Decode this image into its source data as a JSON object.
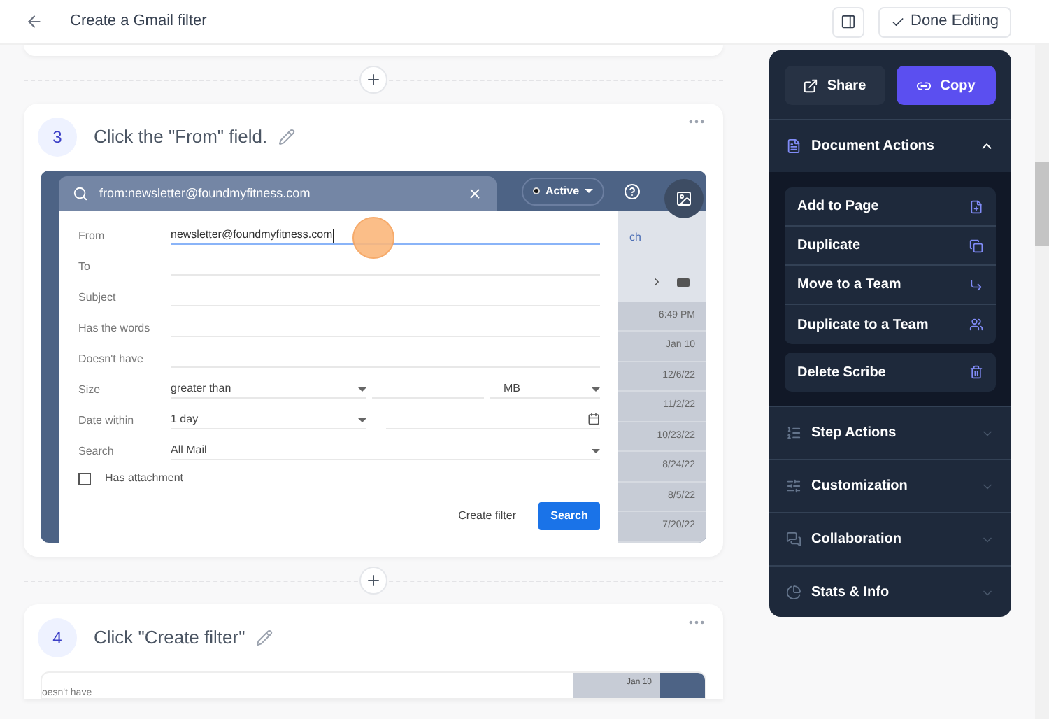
{
  "header": {
    "title": "Create a Gmail filter",
    "done_button": "Done Editing"
  },
  "steps": [
    {
      "number": "3",
      "title": "Click the \"From\" field.",
      "kind": "full",
      "screenshot": {
        "search_query": "from:newsletter@foundmyfitness.com",
        "status": "Active",
        "side_text": "ch",
        "fields": [
          {
            "kind": "text",
            "label": "From",
            "value": "newsletter@foundmyfitness.com",
            "focused": true
          },
          {
            "kind": "text",
            "label": "To",
            "focused": false
          },
          {
            "kind": "text",
            "label": "Subject",
            "focused": false
          },
          {
            "kind": "text",
            "label": "Has the words",
            "focused": false
          },
          {
            "kind": "text",
            "label": "Doesn't have",
            "focused": false
          },
          {
            "kind": "size",
            "label": "Size",
            "value": "greater than",
            "unit": "MB"
          },
          {
            "kind": "date",
            "label": "Date within",
            "value": "1 day"
          },
          {
            "kind": "select",
            "label": "Search",
            "value": "All Mail"
          }
        ],
        "attachment": {
          "label": "Has attachment",
          "checked": false
        },
        "create_filter": "Create filter",
        "search_button": "Search",
        "dates": [
          "6:49 PM",
          "Jan 10",
          "12/6/22",
          "11/2/22",
          "10/23/22",
          "8/24/22",
          "8/5/22",
          "7/20/22"
        ]
      }
    },
    {
      "number": "4",
      "title": "Click \"Create filter\"",
      "kind": "partial",
      "screenshot": {
        "partial_label": "oesn't have",
        "dates": [
          "Jan 10"
        ]
      }
    }
  ],
  "panel": {
    "share": "Share",
    "copy": "Copy",
    "sections": [
      {
        "title": "Document Actions",
        "expanded": true,
        "items": [
          {
            "label": "Add to Page"
          },
          {
            "label": "Duplicate"
          },
          {
            "label": "Move to a Team"
          },
          {
            "label": "Duplicate to a Team"
          }
        ],
        "danger": {
          "label": "Delete Scribe"
        }
      },
      {
        "title": "Step Actions",
        "expanded": false
      },
      {
        "title": "Customization",
        "expanded": false
      },
      {
        "title": "Collaboration",
        "expanded": false
      },
      {
        "title": "Stats & Info",
        "expanded": false
      }
    ]
  }
}
